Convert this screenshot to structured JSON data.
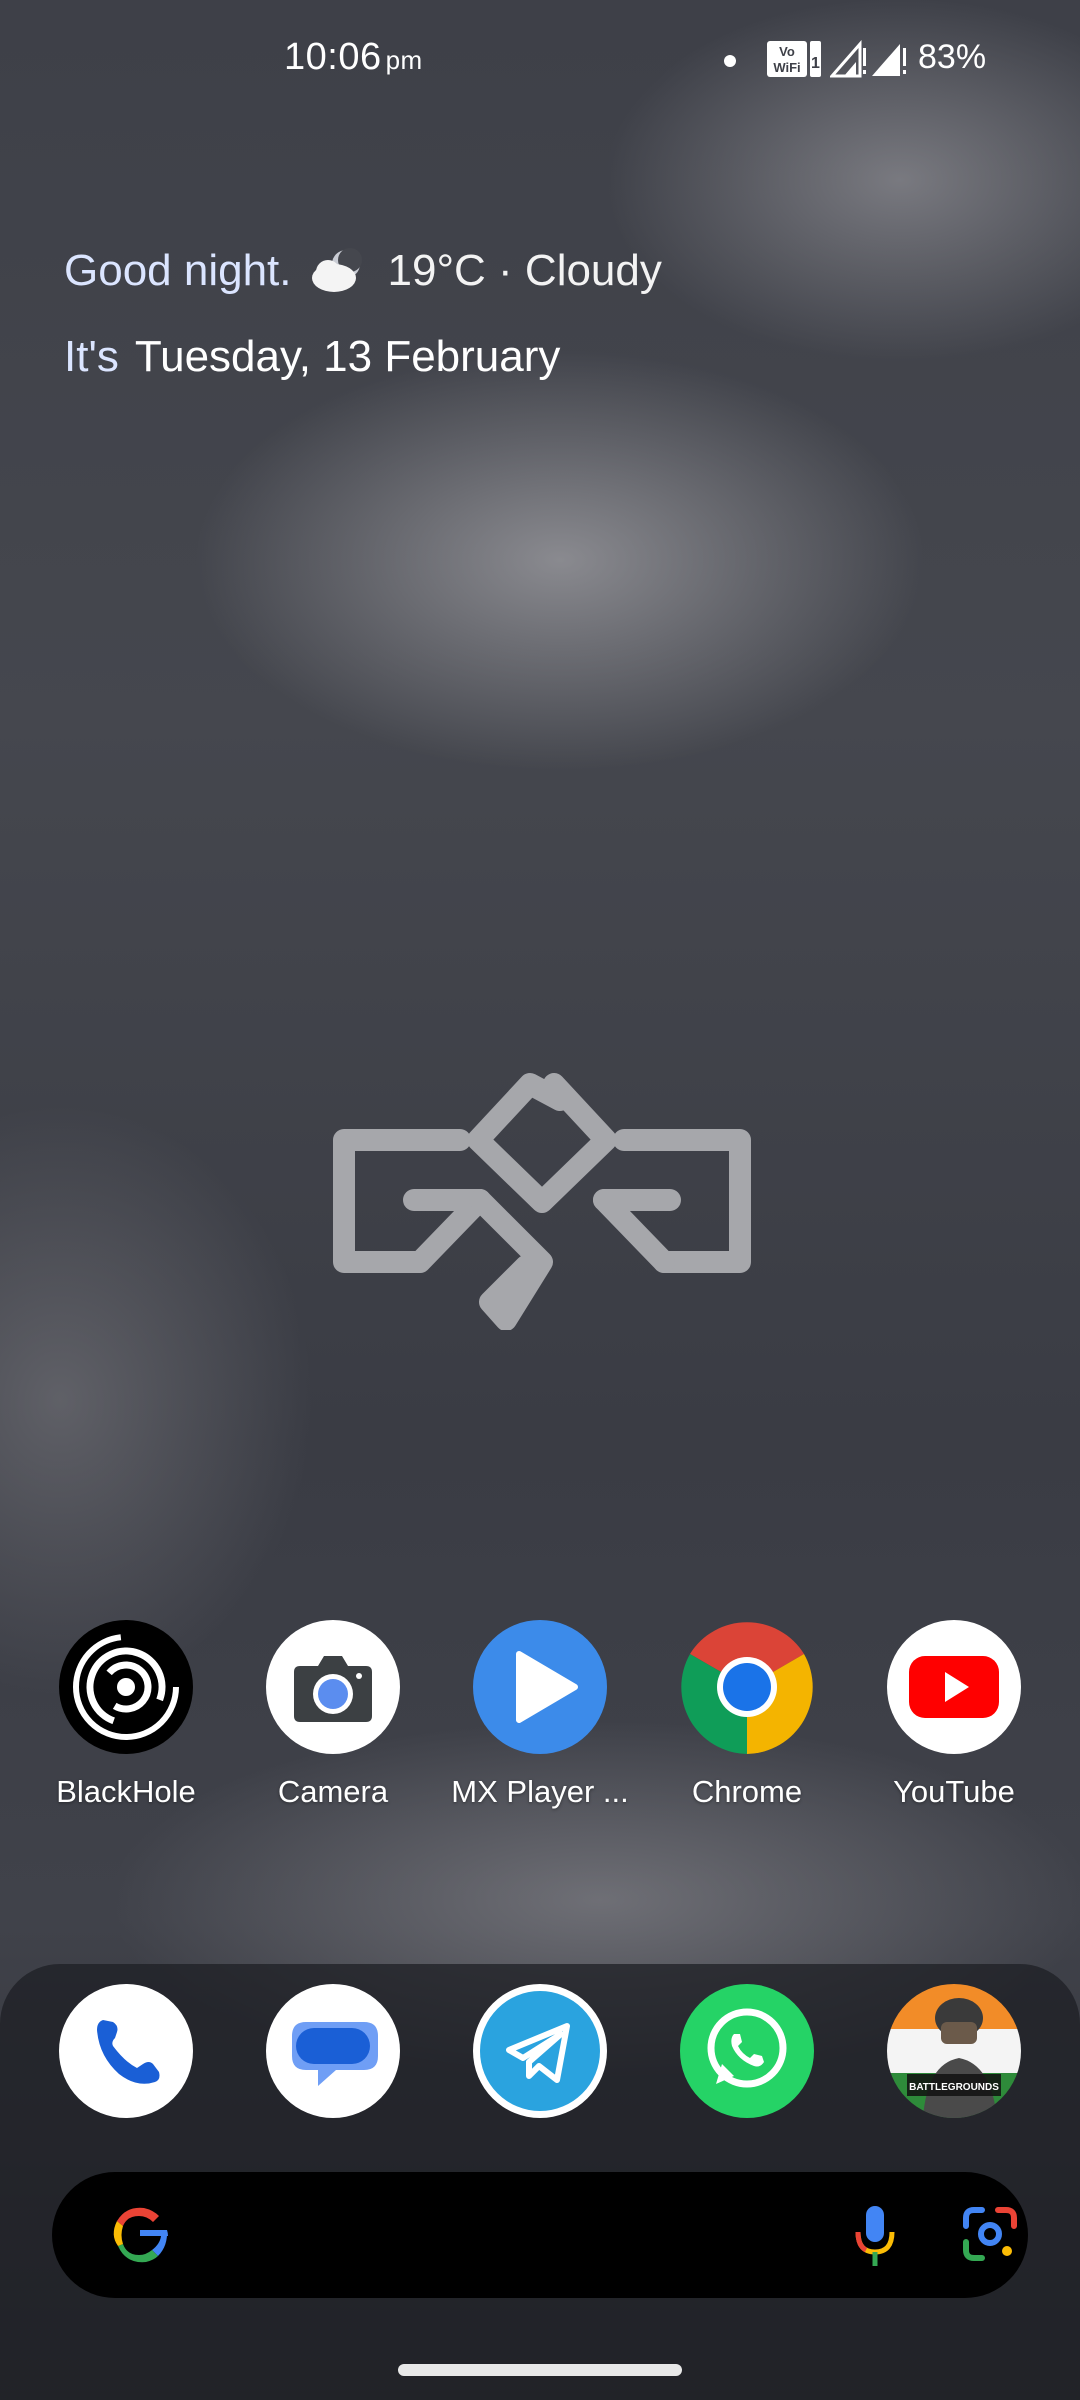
{
  "status_bar": {
    "time": "10:06",
    "ampm": "pm",
    "battery": "83%",
    "icons": [
      "notification-dot-icon",
      "vowifi-icon",
      "signal-icon",
      "signal-icon"
    ]
  },
  "widget": {
    "greeting": "Good night.",
    "weather_icon": "cloudy-night-icon",
    "weather": "19°C · Cloudy",
    "prefix": "It's",
    "date": "Tuesday, 13 February"
  },
  "apps": [
    {
      "label": "BlackHole",
      "icon": "blackhole-icon"
    },
    {
      "label": "Camera",
      "icon": "camera-icon"
    },
    {
      "label": "MX Player ...",
      "icon": "mx-player-icon"
    },
    {
      "label": "Chrome",
      "icon": "chrome-icon"
    },
    {
      "label": "YouTube",
      "icon": "youtube-icon"
    }
  ],
  "dock": [
    {
      "icon": "phone-icon"
    },
    {
      "icon": "messages-icon"
    },
    {
      "icon": "telegram-icon"
    },
    {
      "icon": "whatsapp-icon"
    },
    {
      "icon": "bgmi-icon",
      "logo_text": "BATTLEGROUNDS MOBILE INDIA"
    }
  ],
  "search": {
    "icons": [
      "google-g-icon",
      "mic-icon",
      "google-lens-icon"
    ]
  },
  "colors": {
    "chrome_red": "#DB4437",
    "chrome_yellow": "#F4B400",
    "chrome_green": "#0F9D58",
    "chrome_blue": "#1A73E8",
    "youtube_red": "#FF0000",
    "whatsapp_green": "#25D366",
    "telegram_blue": "#2AA3DF",
    "mx_blue": "#3C8BEA"
  }
}
